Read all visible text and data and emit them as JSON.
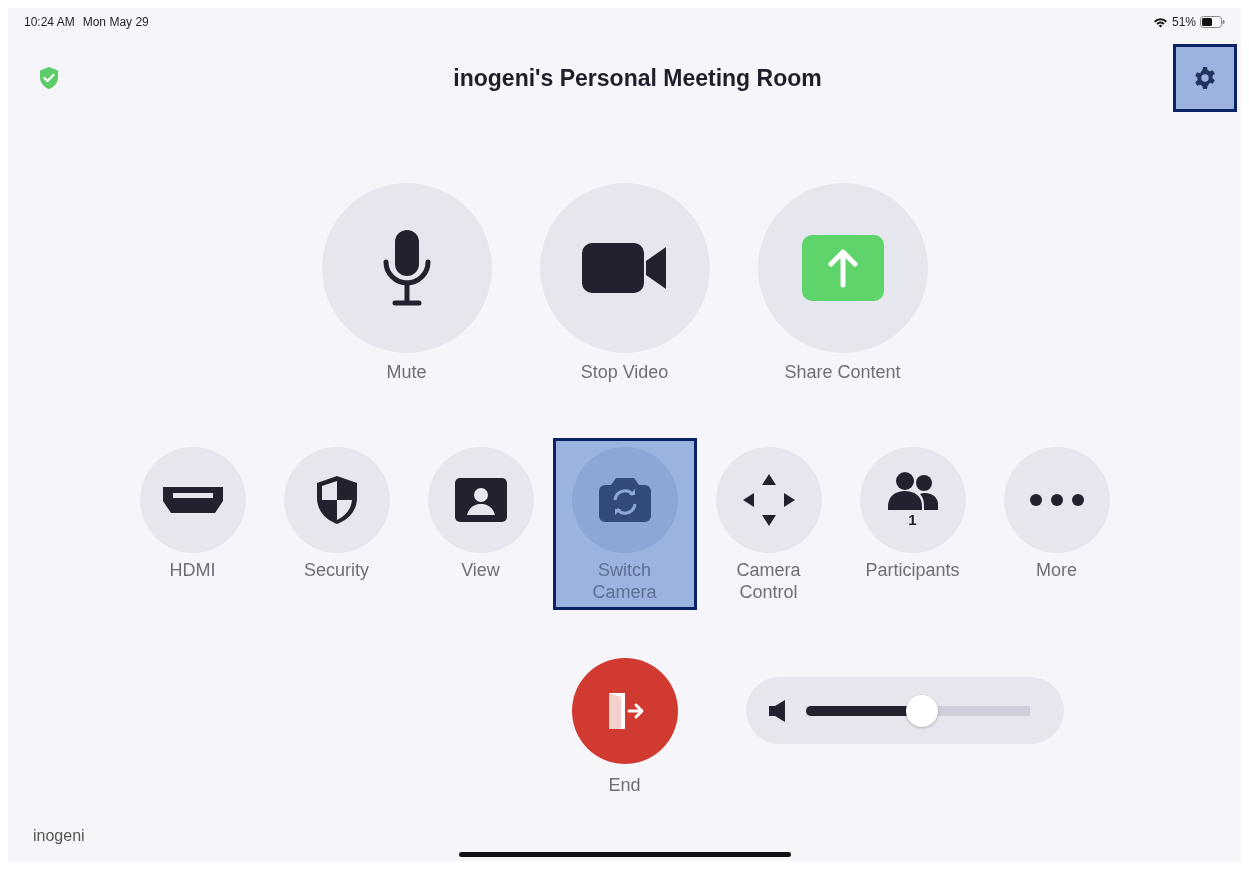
{
  "status_bar": {
    "time": "10:24 AM",
    "date": "Mon May 29",
    "battery": "51%"
  },
  "header": {
    "title": "inogeni's Personal Meeting Room",
    "settings_selected": true
  },
  "main_controls": [
    {
      "kind": "mic",
      "label": "Mute",
      "selected": false
    },
    {
      "kind": "video",
      "label": "Stop Video",
      "selected": false
    },
    {
      "kind": "share",
      "label": "Share Content",
      "selected": false
    }
  ],
  "controls": [
    {
      "kind": "hdmi",
      "label": "HDMI",
      "selected": false
    },
    {
      "kind": "security",
      "label": "Security",
      "selected": false
    },
    {
      "kind": "view",
      "label": "View",
      "selected": false
    },
    {
      "kind": "switchcam",
      "label": "Switch Camera",
      "selected": true
    },
    {
      "kind": "ptz",
      "label": "Camera Control",
      "selected": false
    },
    {
      "kind": "people",
      "label": "Participants",
      "count": "1",
      "selected": false
    },
    {
      "kind": "more",
      "label": "More",
      "selected": false
    }
  ],
  "end_button": {
    "label": "End"
  },
  "volume": {
    "level": 0.52
  },
  "footer": {
    "brand": "inogeni"
  }
}
